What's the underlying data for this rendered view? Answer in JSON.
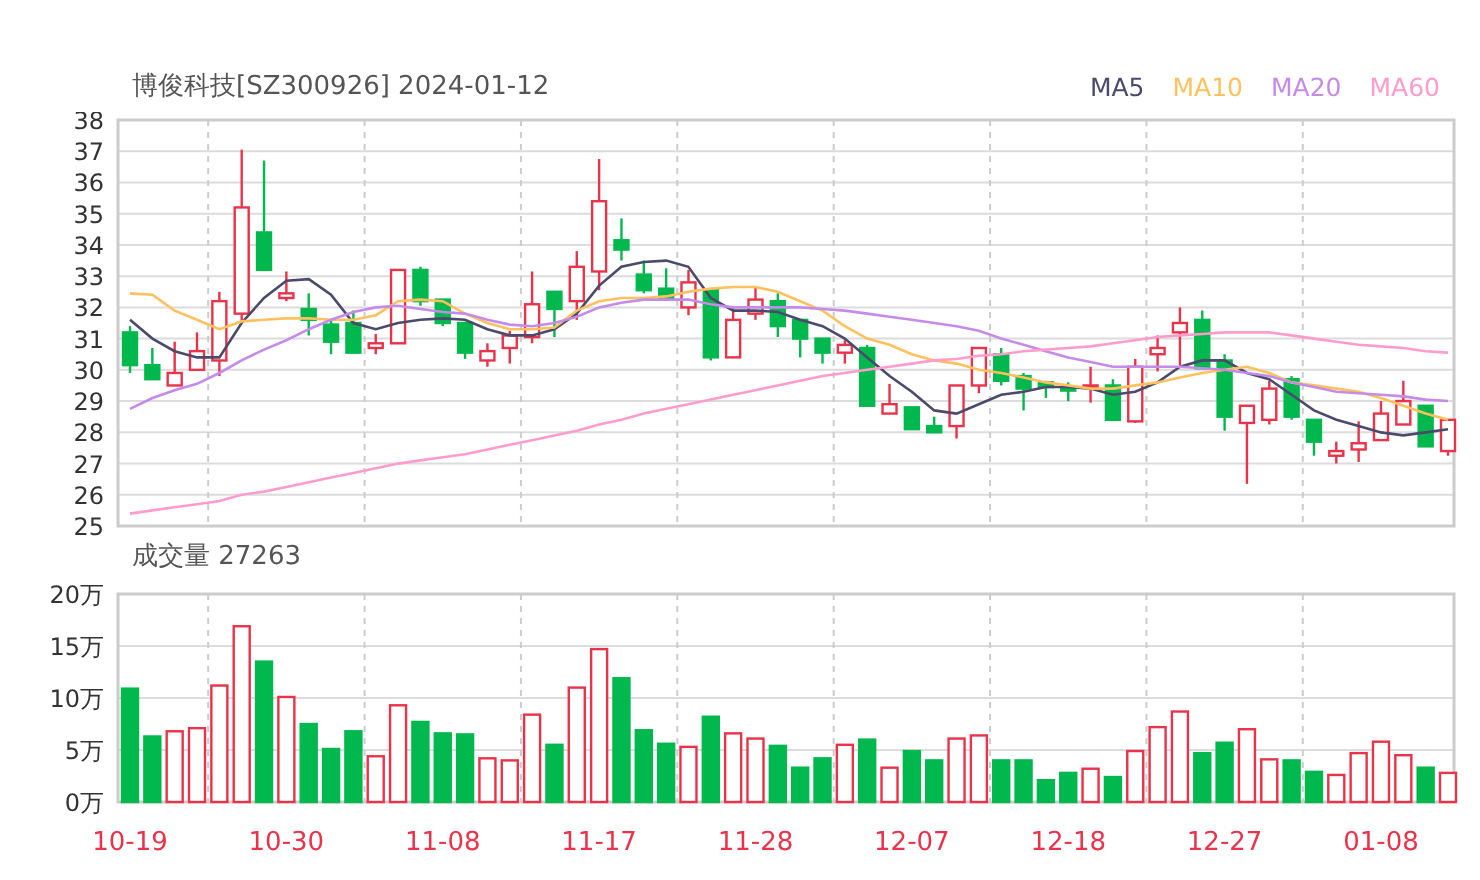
{
  "price_chart": {
    "chart_data": {
      "type": "candlestick",
      "title": "博俊科技[SZ300926] 2024-01-12",
      "grid": true,
      "categories": [
        null,
        null,
        null,
        null,
        null,
        null,
        null,
        null,
        null,
        null,
        null,
        null,
        null,
        null,
        null,
        null,
        null,
        null,
        null,
        null,
        null,
        null,
        null,
        null,
        null,
        null,
        null,
        null,
        null,
        null,
        null,
        null,
        null,
        null,
        null,
        null,
        null,
        null,
        null,
        null,
        null,
        null,
        null,
        null,
        null,
        null,
        null,
        null,
        null,
        null,
        null,
        null,
        null,
        null,
        null,
        null,
        null,
        null,
        null,
        null
      ],
      "ylim": [
        25,
        38
      ],
      "yticks": [
        25,
        26,
        27,
        28,
        29,
        30,
        31,
        32,
        33,
        34,
        35,
        36,
        37,
        38
      ],
      "ohlc": [
        [
          31.2,
          31.4,
          29.9,
          30.15
        ],
        [
          30.15,
          30.7,
          29.7,
          29.7
        ],
        [
          29.5,
          30.9,
          29.5,
          29.9
        ],
        [
          30.0,
          31.2,
          30.0,
          30.6
        ],
        [
          30.3,
          32.5,
          29.8,
          32.2
        ],
        [
          31.8,
          37.05,
          31.5,
          35.2
        ],
        [
          34.4,
          36.7,
          33.2,
          33.2
        ],
        [
          32.3,
          33.15,
          32.2,
          32.45
        ],
        [
          31.95,
          32.45,
          31.1,
          31.6
        ],
        [
          31.45,
          31.6,
          30.5,
          30.9
        ],
        [
          31.5,
          31.9,
          30.55,
          30.55
        ],
        [
          30.7,
          31.15,
          30.5,
          30.85
        ],
        [
          30.85,
          33.2,
          30.85,
          33.2
        ],
        [
          33.2,
          33.3,
          32.05,
          32.2
        ],
        [
          32.25,
          32.25,
          31.4,
          31.5
        ],
        [
          31.5,
          31.5,
          30.35,
          30.55
        ],
        [
          30.3,
          30.85,
          30.1,
          30.6
        ],
        [
          30.7,
          31.25,
          30.2,
          31.1
        ],
        [
          31.05,
          33.15,
          30.85,
          32.1
        ],
        [
          32.5,
          32.5,
          31.05,
          31.95
        ],
        [
          32.2,
          33.8,
          31.6,
          33.3
        ],
        [
          33.15,
          36.75,
          32.55,
          35.4
        ],
        [
          34.15,
          34.85,
          33.5,
          33.85
        ],
        [
          33.05,
          33.5,
          32.45,
          32.55
        ],
        [
          32.6,
          33.25,
          32.25,
          32.25
        ],
        [
          32.0,
          33.2,
          31.75,
          32.8
        ],
        [
          32.55,
          32.55,
          30.3,
          30.4
        ],
        [
          30.4,
          32.0,
          30.4,
          31.6
        ],
        [
          31.8,
          32.65,
          31.6,
          32.25
        ],
        [
          32.2,
          32.45,
          31.05,
          31.4
        ],
        [
          31.6,
          31.6,
          30.4,
          31.0
        ],
        [
          31.0,
          31.0,
          30.2,
          30.55
        ],
        [
          30.55,
          30.95,
          30.2,
          30.8
        ],
        [
          30.7,
          30.8,
          28.85,
          28.85
        ],
        [
          28.6,
          29.55,
          28.6,
          28.9
        ],
        [
          28.8,
          28.8,
          28.1,
          28.1
        ],
        [
          28.2,
          28.5,
          28.0,
          28.0
        ],
        [
          28.2,
          29.5,
          27.8,
          29.5
        ],
        [
          29.5,
          30.7,
          29.25,
          30.7
        ],
        [
          30.5,
          30.7,
          29.5,
          29.65
        ],
        [
          29.8,
          29.9,
          28.7,
          29.4
        ],
        [
          29.6,
          29.65,
          29.1,
          29.45
        ],
        [
          29.4,
          29.6,
          29.0,
          29.35
        ],
        [
          29.45,
          30.1,
          28.95,
          29.5
        ],
        [
          29.5,
          29.7,
          28.4,
          28.4
        ],
        [
          28.35,
          30.35,
          28.3,
          30.1
        ],
        [
          30.5,
          31.1,
          29.95,
          30.7
        ],
        [
          31.2,
          32.0,
          30.15,
          31.5
        ],
        [
          31.6,
          31.9,
          30.05,
          30.05
        ],
        [
          30.3,
          30.5,
          28.05,
          28.5
        ],
        [
          28.3,
          28.85,
          26.35,
          28.85
        ],
        [
          28.4,
          29.65,
          28.25,
          29.4
        ],
        [
          29.7,
          29.8,
          28.4,
          28.5
        ],
        [
          28.4,
          28.4,
          27.25,
          27.7
        ],
        [
          27.25,
          27.7,
          27.0,
          27.4
        ],
        [
          27.45,
          28.35,
          27.05,
          27.65
        ],
        [
          27.75,
          29.0,
          27.75,
          28.6
        ],
        [
          28.25,
          29.65,
          28.25,
          29.0
        ],
        [
          28.85,
          28.85,
          27.55,
          27.55
        ],
        [
          27.4,
          28.4,
          27.25,
          28.4
        ]
      ]
    }
  },
  "moving_averages": {
    "chart_data": {
      "type": "line",
      "ylim": [
        25,
        38
      ],
      "categories": [
        null,
        null,
        null,
        null,
        null,
        null,
        null,
        null,
        null,
        null,
        null,
        null,
        null,
        null,
        null,
        null,
        null,
        null,
        null,
        null,
        null,
        null,
        null,
        null,
        null,
        null,
        null,
        null,
        null,
        null,
        null,
        null,
        null,
        null,
        null,
        null,
        null,
        null,
        null,
        null,
        null,
        null,
        null,
        null,
        null,
        null,
        null,
        null,
        null,
        null,
        null,
        null,
        null,
        null,
        null,
        null,
        null,
        null,
        null,
        null
      ],
      "series": [
        {
          "name": "MA5",
          "color": "#4b4a6b",
          "values": [
            31.6,
            31.0,
            30.6,
            30.4,
            30.4,
            31.5,
            32.3,
            32.85,
            32.9,
            32.4,
            31.5,
            31.3,
            31.5,
            31.6,
            31.65,
            31.6,
            31.3,
            31.1,
            31.1,
            31.3,
            31.8,
            32.7,
            33.3,
            33.45,
            33.5,
            33.3,
            32.3,
            31.9,
            31.9,
            31.85,
            31.6,
            31.4,
            31.0,
            30.4,
            29.8,
            29.3,
            28.7,
            28.6,
            28.9,
            29.2,
            29.3,
            29.45,
            29.45,
            29.4,
            29.2,
            29.3,
            29.6,
            30.1,
            30.3,
            30.3,
            29.9,
            29.7,
            29.2,
            28.7,
            28.4,
            28.2,
            28.0,
            27.9,
            28.0,
            28.1
          ]
        },
        {
          "name": "MA10",
          "color": "#ffc15e",
          "values": [
            32.45,
            32.4,
            31.9,
            31.6,
            31.3,
            31.55,
            31.6,
            31.65,
            31.65,
            31.6,
            31.6,
            31.75,
            32.2,
            32.25,
            32.2,
            31.8,
            31.5,
            31.3,
            31.3,
            31.35,
            31.9,
            32.2,
            32.3,
            32.3,
            32.35,
            32.5,
            32.6,
            32.65,
            32.65,
            32.5,
            32.2,
            31.9,
            31.4,
            31.0,
            30.8,
            30.5,
            30.3,
            30.2,
            30.0,
            29.9,
            29.75,
            29.6,
            29.5,
            29.4,
            29.4,
            29.5,
            29.6,
            29.75,
            29.9,
            30.0,
            30.1,
            29.9,
            29.6,
            29.5,
            29.4,
            29.3,
            29.1,
            28.85,
            28.6,
            28.4
          ]
        },
        {
          "name": "MA20",
          "color": "#c58be8",
          "values": [
            28.75,
            29.1,
            29.35,
            29.55,
            29.9,
            30.3,
            30.65,
            30.95,
            31.3,
            31.6,
            31.85,
            32.0,
            32.05,
            31.95,
            31.85,
            31.8,
            31.6,
            31.45,
            31.4,
            31.5,
            31.7,
            32.0,
            32.15,
            32.25,
            32.25,
            32.25,
            32.1,
            32.0,
            32.0,
            32.0,
            32.0,
            31.95,
            31.9,
            31.8,
            31.7,
            31.6,
            31.5,
            31.4,
            31.25,
            31.0,
            30.8,
            30.6,
            30.4,
            30.25,
            30.1,
            30.1,
            30.1,
            30.1,
            30.05,
            30.0,
            29.9,
            29.8,
            29.6,
            29.45,
            29.3,
            29.25,
            29.2,
            29.15,
            29.05,
            29.0
          ]
        },
        {
          "name": "MA60",
          "color": "#ff9ccc",
          "values": [
            25.4,
            25.5,
            25.6,
            25.7,
            25.8,
            26.0,
            26.1,
            26.25,
            26.4,
            26.55,
            26.7,
            26.85,
            27.0,
            27.1,
            27.2,
            27.3,
            27.45,
            27.6,
            27.75,
            27.9,
            28.05,
            28.25,
            28.4,
            28.6,
            28.75,
            28.9,
            29.05,
            29.2,
            29.35,
            29.5,
            29.65,
            29.8,
            29.9,
            30.0,
            30.1,
            30.2,
            30.3,
            30.35,
            30.45,
            30.5,
            30.6,
            30.65,
            30.7,
            30.75,
            30.85,
            30.95,
            31.05,
            31.1,
            31.15,
            31.2,
            31.2,
            31.2,
            31.1,
            31.0,
            30.9,
            30.8,
            30.75,
            30.7,
            30.6,
            30.55
          ]
        }
      ]
    }
  },
  "volume_chart": {
    "chart_data": {
      "type": "bar",
      "title": "成交量 27263",
      "ylim": [
        0,
        20
      ],
      "grid": true,
      "categories": [
        "10-19",
        null,
        null,
        null,
        null,
        null,
        null,
        "10-30",
        null,
        null,
        null,
        null,
        null,
        null,
        "11-08",
        null,
        null,
        null,
        null,
        null,
        null,
        "11-17",
        null,
        null,
        null,
        null,
        null,
        null,
        "11-28",
        null,
        null,
        null,
        null,
        null,
        null,
        "12-07",
        null,
        null,
        null,
        null,
        null,
        null,
        "12-18",
        null,
        null,
        null,
        null,
        null,
        null,
        "12-27",
        null,
        null,
        null,
        null,
        null,
        null,
        "01-08",
        null,
        null,
        null
      ],
      "yticks": [
        {
          "value": 0,
          "label": "0万"
        },
        {
          "value": 5,
          "label": "5万"
        },
        {
          "value": 10,
          "label": "10万"
        },
        {
          "value": 15,
          "label": "15万"
        },
        {
          "value": 20,
          "label": "20万"
        }
      ],
      "values": [
        10.9,
        6.3,
        6.8,
        7.1,
        11.2,
        16.9,
        13.5,
        10.1,
        7.5,
        5.1,
        6.8,
        4.4,
        9.3,
        7.7,
        6.6,
        6.5,
        4.2,
        4.0,
        8.4,
        5.5,
        11.0,
        14.7,
        11.9,
        6.9,
        5.6,
        5.3,
        8.2,
        6.6,
        6.1,
        5.4,
        3.3,
        4.2,
        5.5,
        6.0,
        3.3,
        4.9,
        4.0,
        6.1,
        6.4,
        4.0,
        4.0,
        2.1,
        2.8,
        3.2,
        2.4,
        4.9,
        7.2,
        8.7,
        4.7,
        5.7,
        7.0,
        4.1,
        4.0,
        2.9,
        2.6,
        4.7,
        5.8,
        4.5,
        3.3,
        2.8
      ]
    }
  }
}
